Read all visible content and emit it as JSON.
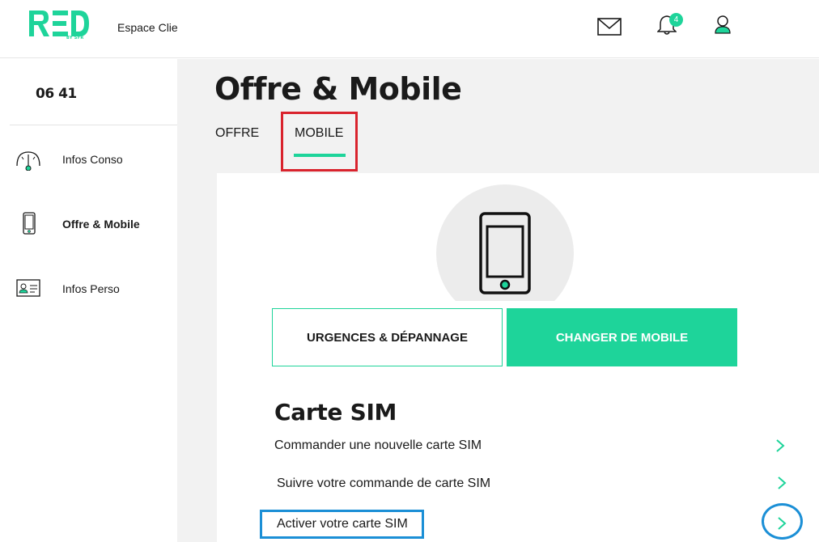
{
  "header": {
    "logo_text": "RED",
    "logo_sub": "BY SFR",
    "espace_label": "Espace Clie",
    "notification_count": "4",
    "icons": [
      "mail-icon",
      "bell-icon",
      "user-icon"
    ]
  },
  "sidebar": {
    "phone_number": "06 41",
    "items": [
      {
        "label": "Infos Conso",
        "icon": "gauge-icon",
        "active": false
      },
      {
        "label": "Offre & Mobile",
        "icon": "smartphone-icon",
        "active": true
      },
      {
        "label": "Infos Perso",
        "icon": "id-card-icon",
        "active": false
      }
    ]
  },
  "main": {
    "title": "Offre & Mobile",
    "tabs": [
      {
        "label": "OFFRE",
        "active": false
      },
      {
        "label": "MOBILE",
        "active": true
      }
    ],
    "buttons": {
      "urgence": "URGENCES & DÉPANNAGE",
      "changer": "CHANGER DE MOBILE"
    },
    "sim_section": {
      "title": "Carte SIM",
      "links": [
        "Commander une nouvelle carte SIM",
        "Suivre votre commande de carte SIM",
        "Activer votre carte SIM"
      ]
    }
  },
  "colors": {
    "brand_green": "#1ed49a",
    "highlight_red": "#d9232d",
    "highlight_blue": "#1b8fd6"
  }
}
